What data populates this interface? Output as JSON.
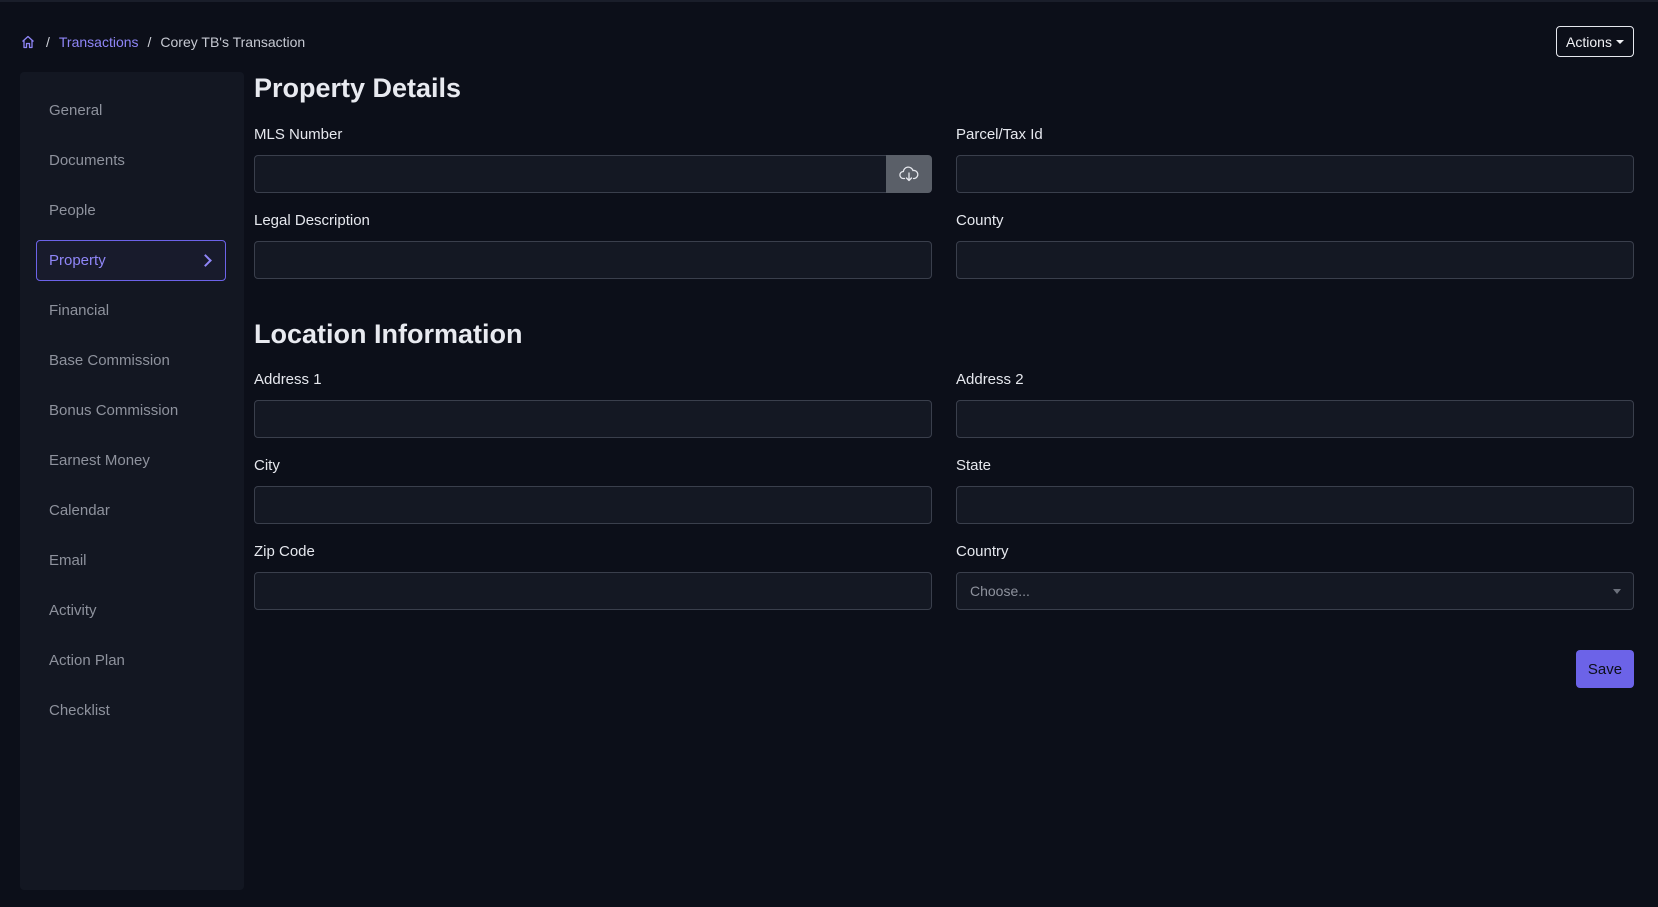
{
  "breadcrumb": {
    "home_icon": "home-icon",
    "separator": "/",
    "link": "Transactions",
    "current": "Corey TB's Transaction"
  },
  "header": {
    "actions_label": "Actions"
  },
  "sidebar": {
    "items": [
      {
        "label": "General"
      },
      {
        "label": "Documents"
      },
      {
        "label": "People"
      },
      {
        "label": "Property",
        "active": true
      },
      {
        "label": "Financial"
      },
      {
        "label": "Base Commission"
      },
      {
        "label": "Bonus Commission"
      },
      {
        "label": "Earnest Money"
      },
      {
        "label": "Calendar"
      },
      {
        "label": "Email"
      },
      {
        "label": "Activity"
      },
      {
        "label": "Action Plan"
      },
      {
        "label": "Checklist"
      }
    ]
  },
  "property_details": {
    "title": "Property Details",
    "mls_number": {
      "label": "MLS Number",
      "value": ""
    },
    "mls_import_icon": "cloud-download-icon",
    "parcel_tax_id": {
      "label": "Parcel/Tax Id",
      "value": ""
    },
    "legal_description": {
      "label": "Legal Description",
      "value": ""
    },
    "county": {
      "label": "County",
      "value": ""
    }
  },
  "location_information": {
    "title": "Location Information",
    "address1": {
      "label": "Address 1",
      "value": ""
    },
    "address2": {
      "label": "Address 2",
      "value": ""
    },
    "city": {
      "label": "City",
      "value": ""
    },
    "state": {
      "label": "State",
      "value": ""
    },
    "zip_code": {
      "label": "Zip Code",
      "value": ""
    },
    "country": {
      "label": "Country",
      "selected": "Choose..."
    }
  },
  "save_label": "Save",
  "colors": {
    "background": "#0c0f19",
    "sidebar": "#131722",
    "accent": "#6c63e8",
    "link": "#8f86f7"
  }
}
